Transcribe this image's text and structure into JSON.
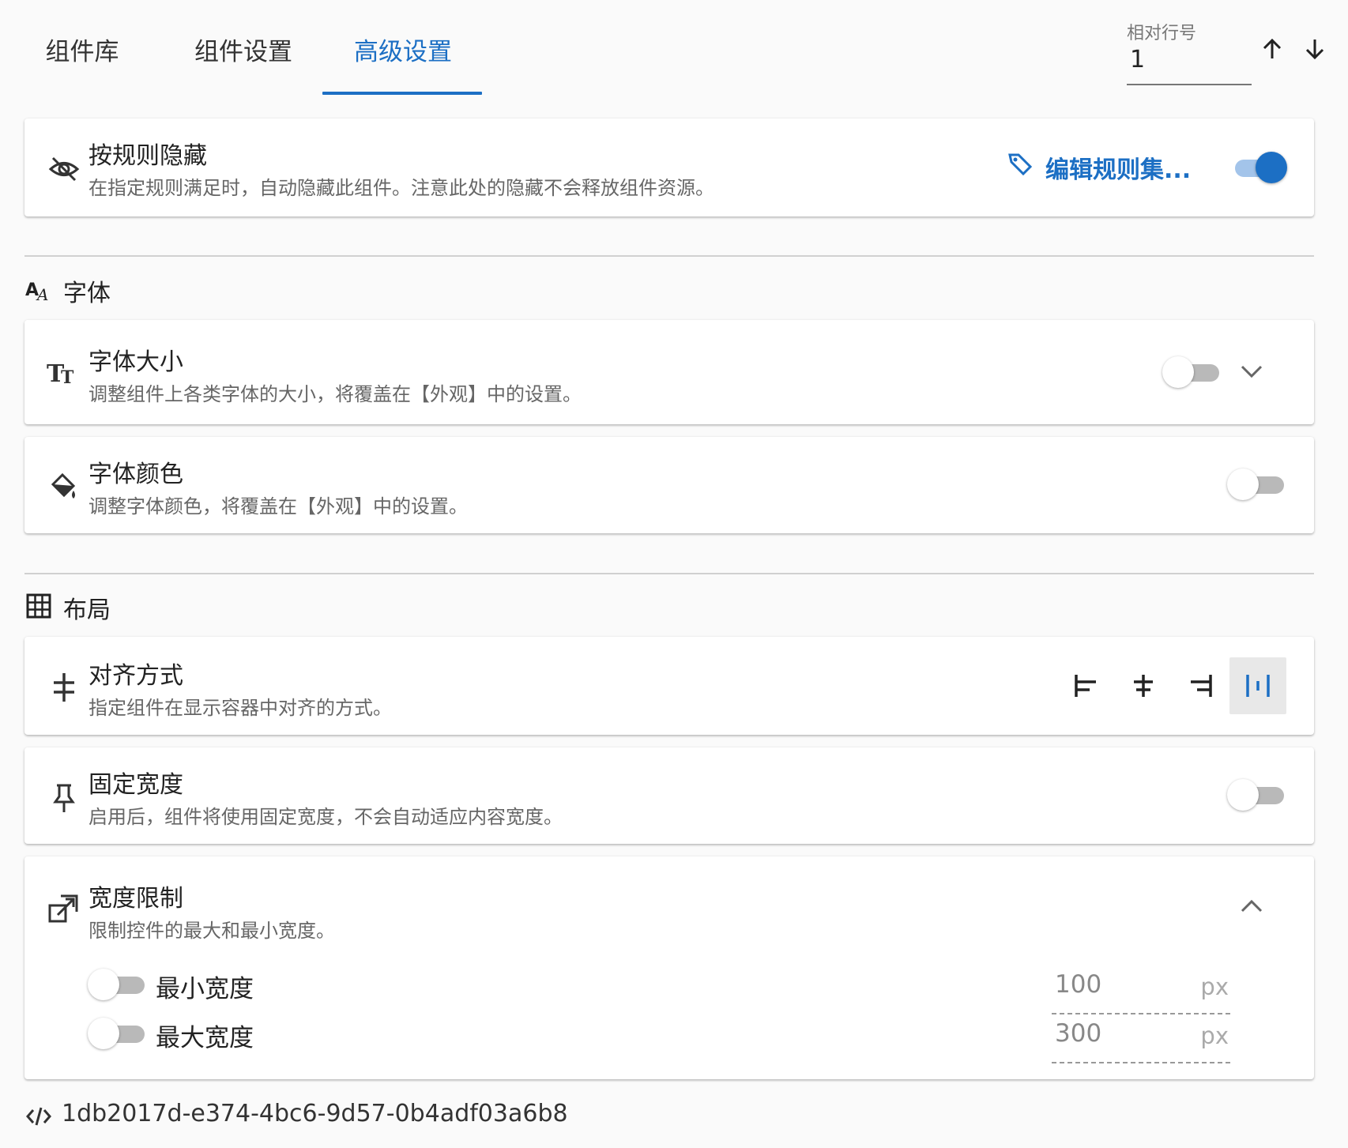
{
  "tabs": [
    {
      "label": "组件库"
    },
    {
      "label": "组件设置"
    },
    {
      "label": "高级设置"
    }
  ],
  "active_tab": "高级设置",
  "row_field": {
    "label": "相对行号",
    "value": "1"
  },
  "hide_rule": {
    "title": "按规则隐藏",
    "desc": "在指定规则满足时，自动隐藏此组件。注意此处的隐藏不会释放组件资源。",
    "edit_label": "编辑规则集...",
    "enabled": true
  },
  "font_section": {
    "title": "字体",
    "font_size": {
      "title": "字体大小",
      "desc": "调整组件上各类字体的大小，将覆盖在【外观】中的设置。",
      "enabled": false
    },
    "font_color": {
      "title": "字体颜色",
      "desc": "调整字体颜色，将覆盖在【外观】中的设置。",
      "enabled": false
    }
  },
  "layout_section": {
    "title": "布局",
    "align": {
      "title": "对齐方式",
      "desc": "指定组件在显示容器中对齐的方式。",
      "options": [
        "align-left-icon",
        "align-center-icon",
        "align-right-icon",
        "align-stretch-icon"
      ],
      "selected": 3
    },
    "fixed_width": {
      "title": "固定宽度",
      "desc": "启用后，组件将使用固定宽度，不会自动适应内容宽度。",
      "enabled": false
    },
    "width_limit": {
      "title": "宽度限制",
      "desc": "限制控件的最大和最小宽度。",
      "min": {
        "label": "最小宽度",
        "value": "100",
        "unit": "px",
        "enabled": false
      },
      "max": {
        "label": "最大宽度",
        "value": "300",
        "unit": "px",
        "enabled": false
      }
    }
  },
  "footer": {
    "id": "1db2017d-e374-4bc6-9d57-0b4adf03a6b8"
  },
  "colors": {
    "accent": "#1c6fc4",
    "switch_off": "#b9b9b9"
  }
}
